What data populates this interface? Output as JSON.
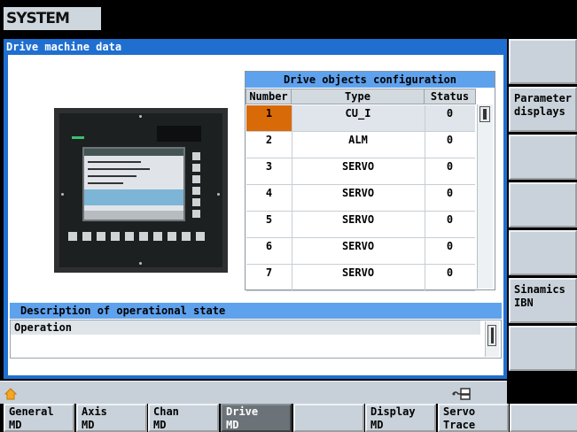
{
  "header": {
    "system_label": "SYSTEM"
  },
  "window": {
    "title": "Drive machine data"
  },
  "drive_objects": {
    "title": "Drive objects configuration",
    "columns": [
      "Number",
      "Type",
      "Status"
    ],
    "rows": [
      {
        "number": "1",
        "type": "CU_I",
        "status": "0"
      },
      {
        "number": "2",
        "type": "ALM",
        "status": "0"
      },
      {
        "number": "3",
        "type": "SERVO",
        "status": "0"
      },
      {
        "number": "4",
        "type": "SERVO",
        "status": "0"
      },
      {
        "number": "5",
        "type": "SERVO",
        "status": "0"
      },
      {
        "number": "6",
        "type": "SERVO",
        "status": "0"
      },
      {
        "number": "7",
        "type": "SERVO",
        "status": "0"
      }
    ],
    "selected_row": 1
  },
  "description": {
    "title": "Description of operational state",
    "value": "Operation"
  },
  "softkeys_horizontal": [
    {
      "label": "General\nMD",
      "active": false
    },
    {
      "label": "Axis\nMD",
      "active": false
    },
    {
      "label": "Chan\nMD",
      "active": false
    },
    {
      "label": "Drive\nMD",
      "active": true
    },
    {
      "label": "",
      "active": false
    },
    {
      "label": "Display\nMD",
      "active": false
    },
    {
      "label": "Servo\nTrace",
      "active": false
    },
    {
      "label": "",
      "active": false
    }
  ],
  "softkeys_vertical": [
    {
      "label": ""
    },
    {
      "label": "Parameter\ndisplays"
    },
    {
      "label": ""
    },
    {
      "label": ""
    },
    {
      "label": ""
    },
    {
      "label": "Sinamics\nIBN"
    },
    {
      "label": ""
    },
    {
      "label": ""
    }
  ],
  "icons": {
    "home": "home-icon",
    "network": "network-connection-icon"
  },
  "colors": {
    "title_bar": "#1f6fd0",
    "table_header": "#5ea2ee",
    "selection": "#d96a08",
    "softkey": "#c9d2da",
    "softkey_active": "#6b7278"
  }
}
